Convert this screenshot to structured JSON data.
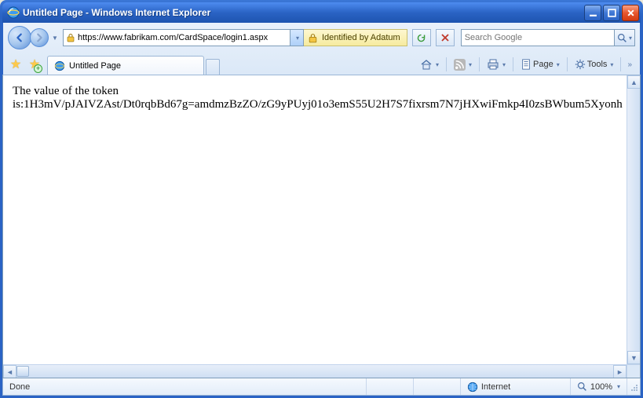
{
  "window": {
    "title": "Untitled Page - Windows Internet Explorer"
  },
  "address": {
    "url": "https://www.fabrikam.com/CardSpace/login1.aspx",
    "identity_label": "Identified by Adatum"
  },
  "search": {
    "placeholder": "Search Google"
  },
  "tab": {
    "title": "Untitled Page"
  },
  "toolbar": {
    "page_label": "Page",
    "tools_label": "Tools"
  },
  "page_body": {
    "line1": "The value of the token",
    "line2": "is:1H3mV/pJAIVZAst/Dt0rqbBd67g=amdmzBzZO/zG9yPUyj01o3emS55U2H7S7fixrsm7N7jHXwiFmkp4I0zsBWbum5Xyonh"
  },
  "status": {
    "left": "Done",
    "zone": "Internet",
    "zoom": "100%"
  }
}
